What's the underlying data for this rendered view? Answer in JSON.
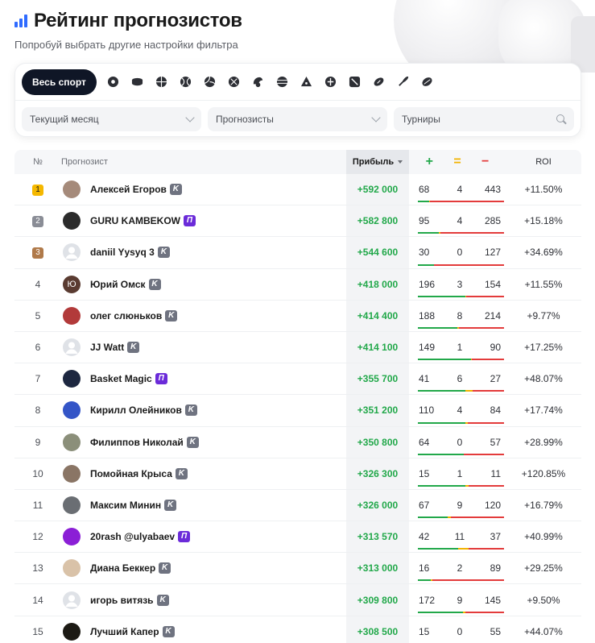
{
  "header": {
    "title": "Рейтинг прогнозистов",
    "subtitle": "Попробуй выбрать другие настройки фильтра"
  },
  "filters": {
    "all_sports_label": "Весь спорт",
    "sport_icons": [
      "soccer-ball-icon",
      "hockey-puck-icon",
      "basketball-icon",
      "tennis-icon",
      "volleyball-icon",
      "handball-icon",
      "esports-icon",
      "table-tennis-icon",
      "billiards-icon",
      "cybersport-icon",
      "mma-icon",
      "american-football-icon",
      "badminton-icon",
      "rugby-icon"
    ],
    "period": "Текущий месяц",
    "type": "Прогнозисты",
    "tournaments_placeholder": "Турниры"
  },
  "table": {
    "headers": {
      "num": "№",
      "name": "Прогнозист",
      "profit": "Прибыль",
      "plus": "+",
      "eq": "=",
      "minus": "−",
      "roi": "ROI"
    },
    "colors": {
      "win": "#22a84a",
      "draw": "#f2b300",
      "loss": "#e33b3b",
      "tag_k": "#6f7380",
      "tag_p": "#6b2bd9",
      "gold": "#f5b800",
      "silver": "#8a8d96",
      "bronze": "#b07a4a"
    },
    "rows": [
      {
        "rank": "1",
        "name": "Алексей Егоров",
        "tag": "K",
        "profit": "+592 000",
        "w": "68",
        "d": "4",
        "l": "443",
        "roi": "+11.50%",
        "avatar": "#a58a7a"
      },
      {
        "rank": "2",
        "name": "GURU KAMBEKOW",
        "tag": "П",
        "profit": "+582 800",
        "w": "95",
        "d": "4",
        "l": "285",
        "roi": "+15.18%",
        "avatar": "#2b2b2b"
      },
      {
        "rank": "3",
        "name": "daniil Yysyq 3",
        "tag": "K",
        "profit": "+544 600",
        "w": "30",
        "d": "0",
        "l": "127",
        "roi": "+34.69%",
        "avatar": "#dfe2e7"
      },
      {
        "rank": "4",
        "name": "Юрий Омск",
        "tag": "K",
        "profit": "+418 000",
        "w": "196",
        "d": "3",
        "l": "154",
        "roi": "+11.55%",
        "avatar": "#5a3b31",
        "initial": "Ю"
      },
      {
        "rank": "5",
        "name": "олег слюньков",
        "tag": "K",
        "profit": "+414 400",
        "w": "188",
        "d": "8",
        "l": "214",
        "roi": "+9.77%",
        "avatar": "#b23a3a"
      },
      {
        "rank": "6",
        "name": "JJ Watt",
        "tag": "K",
        "profit": "+414 100",
        "w": "149",
        "d": "1",
        "l": "90",
        "roi": "+17.25%",
        "avatar": "#dfe2e7"
      },
      {
        "rank": "7",
        "name": "Basket Magic",
        "tag": "П",
        "profit": "+355 700",
        "w": "41",
        "d": "6",
        "l": "27",
        "roi": "+48.07%",
        "avatar": "#1d2740"
      },
      {
        "rank": "8",
        "name": "Кирилл Олейников",
        "tag": "K",
        "profit": "+351 200",
        "w": "110",
        "d": "4",
        "l": "84",
        "roi": "+17.74%",
        "avatar": "#3455c7"
      },
      {
        "rank": "9",
        "name": "Филиппов Николай",
        "tag": "K",
        "profit": "+350 800",
        "w": "64",
        "d": "0",
        "l": "57",
        "roi": "+28.99%",
        "avatar": "#8b8f7a"
      },
      {
        "rank": "10",
        "name": "Помойная Крыса",
        "tag": "K",
        "profit": "+326 300",
        "w": "15",
        "d": "1",
        "l": "11",
        "roi": "+120.85%",
        "avatar": "#8a7565"
      },
      {
        "rank": "11",
        "name": "Максим Минин",
        "tag": "K",
        "profit": "+326 000",
        "w": "67",
        "d": "9",
        "l": "120",
        "roi": "+16.79%",
        "avatar": "#6a6e73"
      },
      {
        "rank": "12",
        "name": "20rash @ulyabaev",
        "tag": "П",
        "profit": "+313 570",
        "w": "42",
        "d": "11",
        "l": "37",
        "roi": "+40.99%",
        "avatar": "#8b1fd6"
      },
      {
        "rank": "13",
        "name": "Диана Беккер",
        "tag": "K",
        "profit": "+313 000",
        "w": "16",
        "d": "2",
        "l": "89",
        "roi": "+29.25%",
        "avatar": "#d9c2a8"
      },
      {
        "rank": "14",
        "name": "игорь витязь",
        "tag": "K",
        "profit": "+309 800",
        "w": "172",
        "d": "9",
        "l": "145",
        "roi": "+9.50%",
        "avatar": "#dfe2e7"
      },
      {
        "rank": "15",
        "name": "Лучший Капер",
        "tag": "K",
        "profit": "+308 500",
        "w": "15",
        "d": "0",
        "l": "55",
        "roi": "+44.07%",
        "avatar": "#1c1a14"
      }
    ]
  }
}
